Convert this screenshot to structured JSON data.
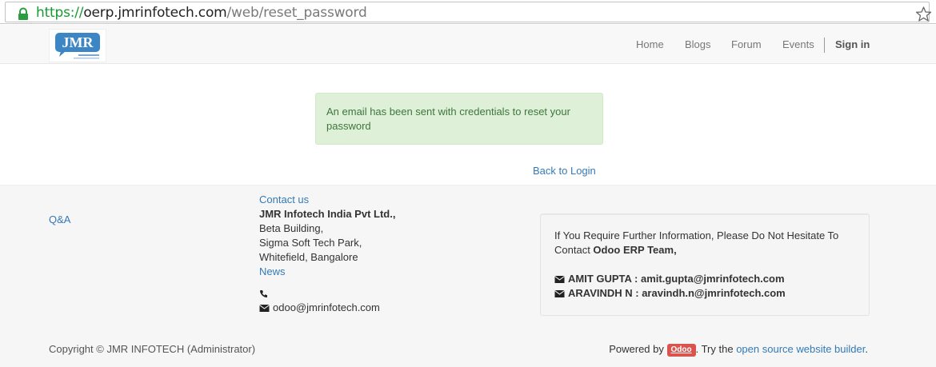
{
  "browser": {
    "url_scheme": "https://",
    "url_host": "oerp.jmrinfotech.com",
    "url_path": "/web/reset_password"
  },
  "header": {
    "logo_text": "JMR",
    "nav": [
      "Home",
      "Blogs",
      "Forum",
      "Events"
    ],
    "sign_in": "Sign in"
  },
  "alert": {
    "message": "An email has been sent with credentials to reset your password",
    "color": "#dff0d8"
  },
  "back_to_login": "Back to Login",
  "footer": {
    "qa_link": "Q&A",
    "contact_us": "Contact us",
    "company": "JMR Infotech India Pvt Ltd.,",
    "address": [
      "Beta Building,",
      "Sigma Soft Tech Park,",
      "Whitefield, Bangalore"
    ],
    "news": "News",
    "email": "odoo@jmrinfotech.com",
    "info_line1": "If You Require Further Information, Please Do Not Hesitate To",
    "info_line2_prefix": "Contact ",
    "info_line2_bold": "Odoo ERP Team,",
    "contacts": [
      "AMIT GUPTA : amit.gupta@jmrinfotech.com",
      "ARAVINDH N : aravindh.n@jmrinfotech.com"
    ],
    "copyright": "Copyright © JMR INFOTECH (Administrator)",
    "powered_by": "Powered by",
    "odoo_badge": "Odoo",
    "try_the": ". Try the",
    "builder_link": "open source website builder",
    "period": "."
  },
  "colors": {
    "link": "#337ab7",
    "url_green": "#159a2f",
    "badge_red": "#d9534f"
  }
}
